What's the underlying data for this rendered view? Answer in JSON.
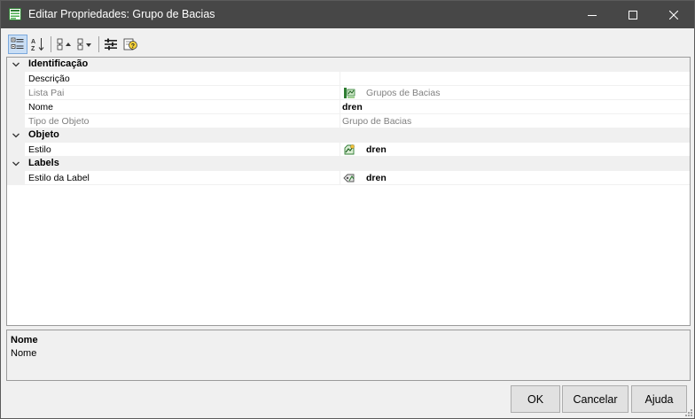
{
  "window": {
    "title": "Editar Propriedades: Grupo de Bacias",
    "icon": "app-properties-icon",
    "controls": [
      "minimize-icon",
      "maximize-icon",
      "close-icon"
    ],
    "titlebar_color": "#474747"
  },
  "toolbar": {
    "buttons": [
      {
        "name": "categorized-view-button",
        "icon": "categorized-icon",
        "active": true
      },
      {
        "name": "alphabetical-view-button",
        "icon": "sort-az-icon",
        "active": false
      },
      {
        "name": "collapse-all-button",
        "icon": "collapse-icon",
        "active": false
      },
      {
        "name": "expand-all-button",
        "icon": "expand-icon",
        "active": false
      },
      {
        "name": "property-pages-button",
        "icon": "property-pages-icon",
        "active": false
      },
      {
        "name": "help-button",
        "icon": "help-icon",
        "active": false
      }
    ]
  },
  "grid": {
    "categories": [
      {
        "label": "Identificação",
        "properties": [
          {
            "name": "Descrição",
            "value": "",
            "readonly": false
          },
          {
            "name": "Lista Pai",
            "value": "Grupos de Bacias",
            "readonly": true,
            "icon": "basin-group-icon"
          },
          {
            "name": "Nome",
            "value": "dren",
            "readonly": false,
            "bold": true
          },
          {
            "name": "Tipo de Objeto",
            "value": "Grupo de Bacias",
            "readonly": true
          }
        ]
      },
      {
        "label": "Objeto",
        "properties": [
          {
            "name": "Estilo",
            "value": "dren",
            "readonly": false,
            "bold": true,
            "icon": "style-icon"
          }
        ]
      },
      {
        "label": "Labels",
        "properties": [
          {
            "name": "Estilo da Label",
            "value": "dren",
            "readonly": false,
            "bold": true,
            "icon": "label-style-icon"
          }
        ]
      }
    ]
  },
  "description": {
    "title": "Nome",
    "text": "Nome"
  },
  "buttons": {
    "ok": "OK",
    "cancel": "Cancelar",
    "help": "Ajuda"
  }
}
